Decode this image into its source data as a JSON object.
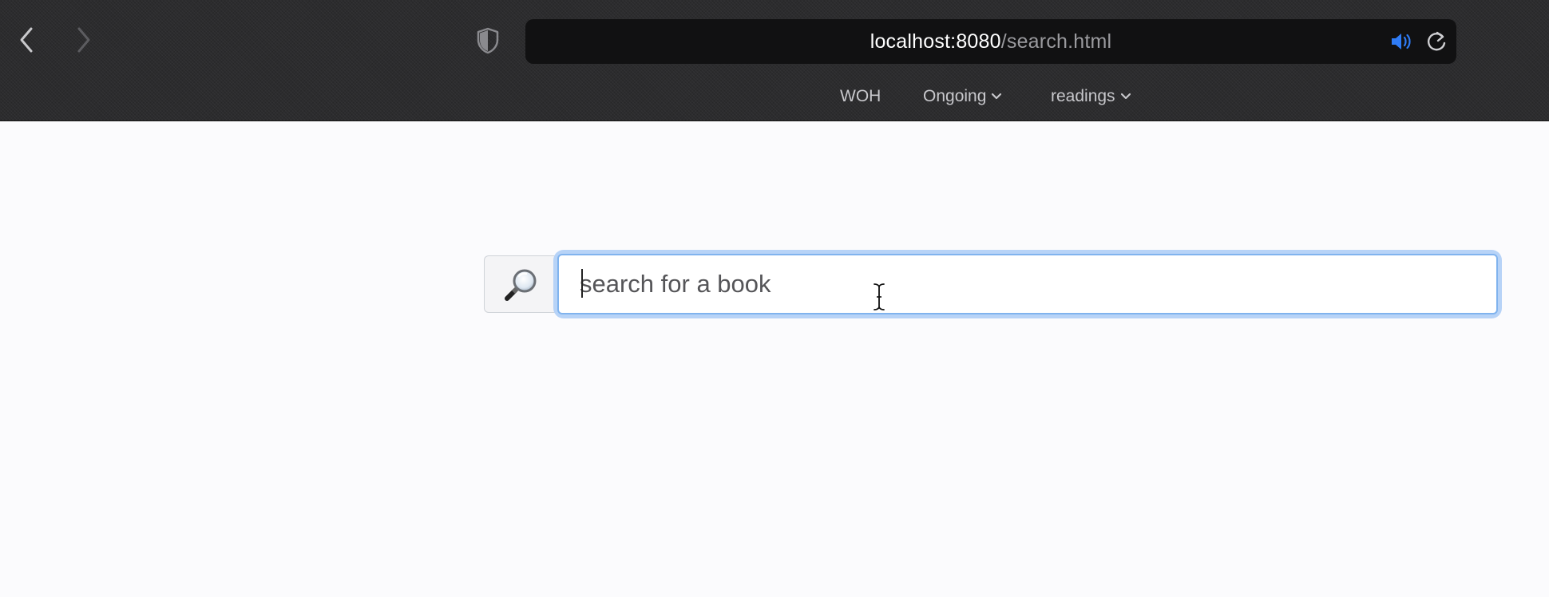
{
  "browser": {
    "url_host": "localhost:8080",
    "url_path": "/search.html",
    "favorites": [
      {
        "label": "WOH",
        "has_menu": false
      },
      {
        "label": "Ongoing",
        "has_menu": true
      },
      {
        "label": "readings",
        "has_menu": true
      }
    ],
    "icons": {
      "back": "chevron-left-icon",
      "forward": "chevron-right-icon",
      "privacy": "shield-icon",
      "audio": "speaker-icon",
      "reload": "reload-icon"
    },
    "audio_color": "#2f7cf6"
  },
  "search": {
    "placeholder": "search for a book",
    "value": "",
    "icon": "magnifying-glass-icon",
    "focus_ring_color": "#b7d3f7"
  }
}
